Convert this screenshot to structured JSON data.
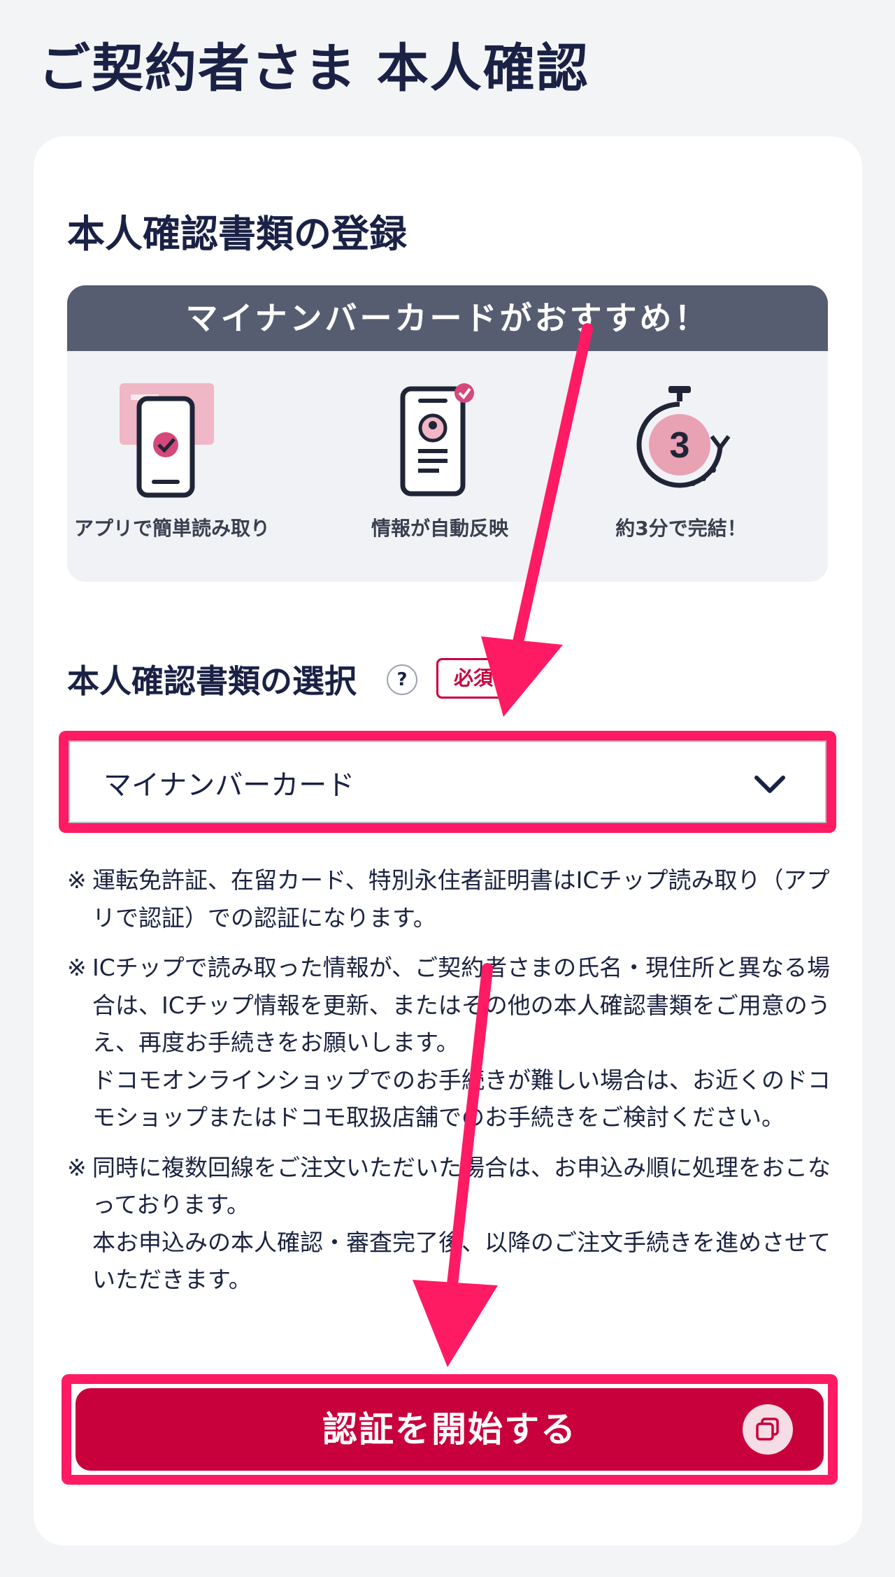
{
  "page": {
    "title": "ご契約者さま 本人確認"
  },
  "registration": {
    "title": "本人確認書類の登録",
    "promo": {
      "header": "マイナンバーカードがおすすめ！",
      "features": [
        {
          "icon": "phone-card-scan-icon",
          "label": "アプリで簡単読み取り"
        },
        {
          "icon": "phone-profile-icon",
          "label": "情報が自動反映"
        },
        {
          "icon": "stopwatch-3-icon",
          "label": "約3分で完結！"
        }
      ]
    }
  },
  "document_select": {
    "label": "本人確認書類の選択",
    "help": "?",
    "required": "必須",
    "value": "マイナンバーカード"
  },
  "notes": [
    {
      "mark": "※",
      "lines": [
        "運転免許証、在留カード、特別永住者証明書はICチップ読み取り（アプリで認証）での認証になります。"
      ]
    },
    {
      "mark": "※",
      "lines": [
        "ICチップで読み取った情報が、ご契約者さまの氏名・現住所と異なる場合は、ICチップ情報を更新、またはその他の本人確認書類をご用意のうえ、再度お手続きをお願いします。",
        "ドコモオンラインショップでのお手続きが難しい場合は、お近くのドコモショップまたはドコモ取扱店舗でのお手続きをご検討ください。"
      ]
    },
    {
      "mark": "※",
      "lines": [
        "同時に複数回線をご注文いただいた場合は、お申込み順に処理をおこなっております。",
        "本お申込みの本人確認・審査完了後、以降のご注文手続きを進めさせていただきます。"
      ]
    }
  ],
  "cta": {
    "label": "認証を開始する",
    "icon": "external-window-icon"
  },
  "colors": {
    "accent": "#c8003c",
    "highlight": "#ff1a64",
    "promo_header": "#575d70",
    "title": "#1a2145"
  }
}
